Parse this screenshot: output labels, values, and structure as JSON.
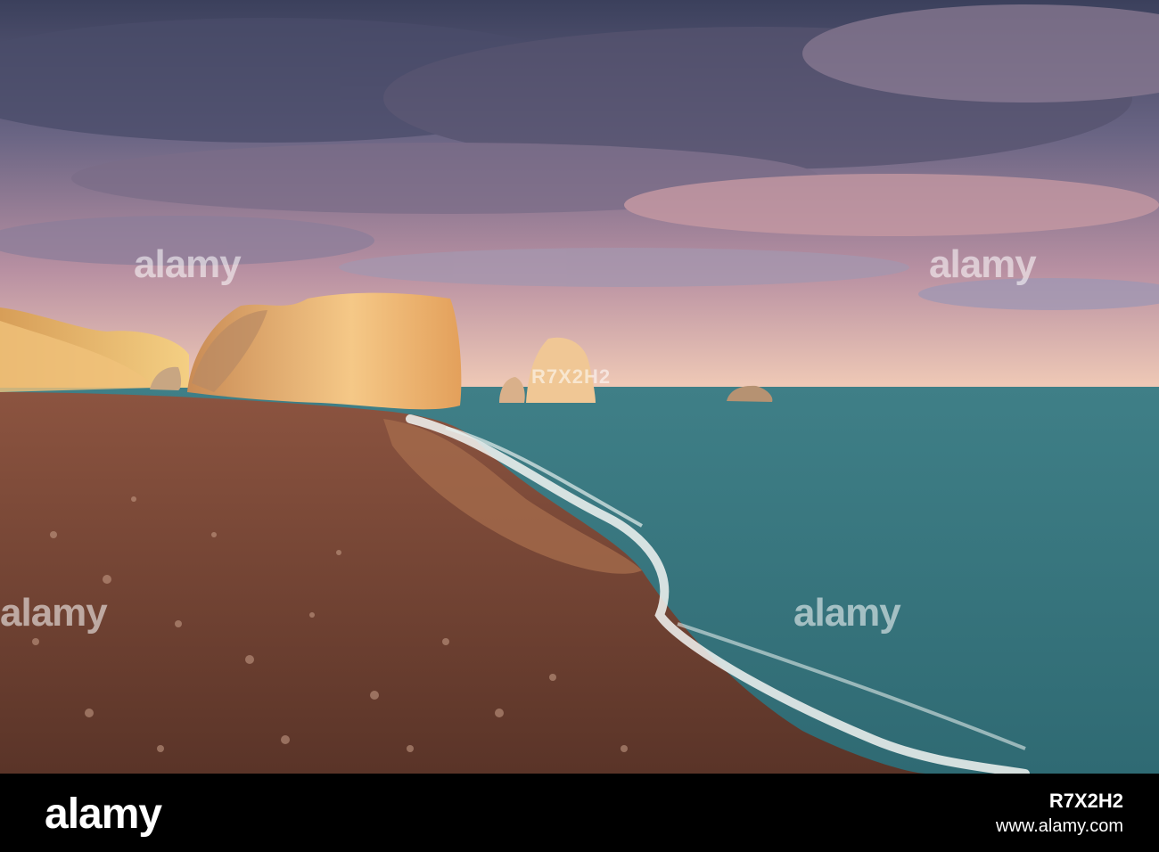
{
  "watermark": {
    "brand": "alamy",
    "image_id": "R7X2H2",
    "url": "www.alamy.com"
  },
  "scene": {
    "sky_colors": [
      "#3e4561",
      "#6f6a86",
      "#c99aa4",
      "#f0c9b0"
    ],
    "sea_color": "#4c8a8e",
    "beach_color": "#7d4a37",
    "rock_light_color": "#f2b66d"
  }
}
